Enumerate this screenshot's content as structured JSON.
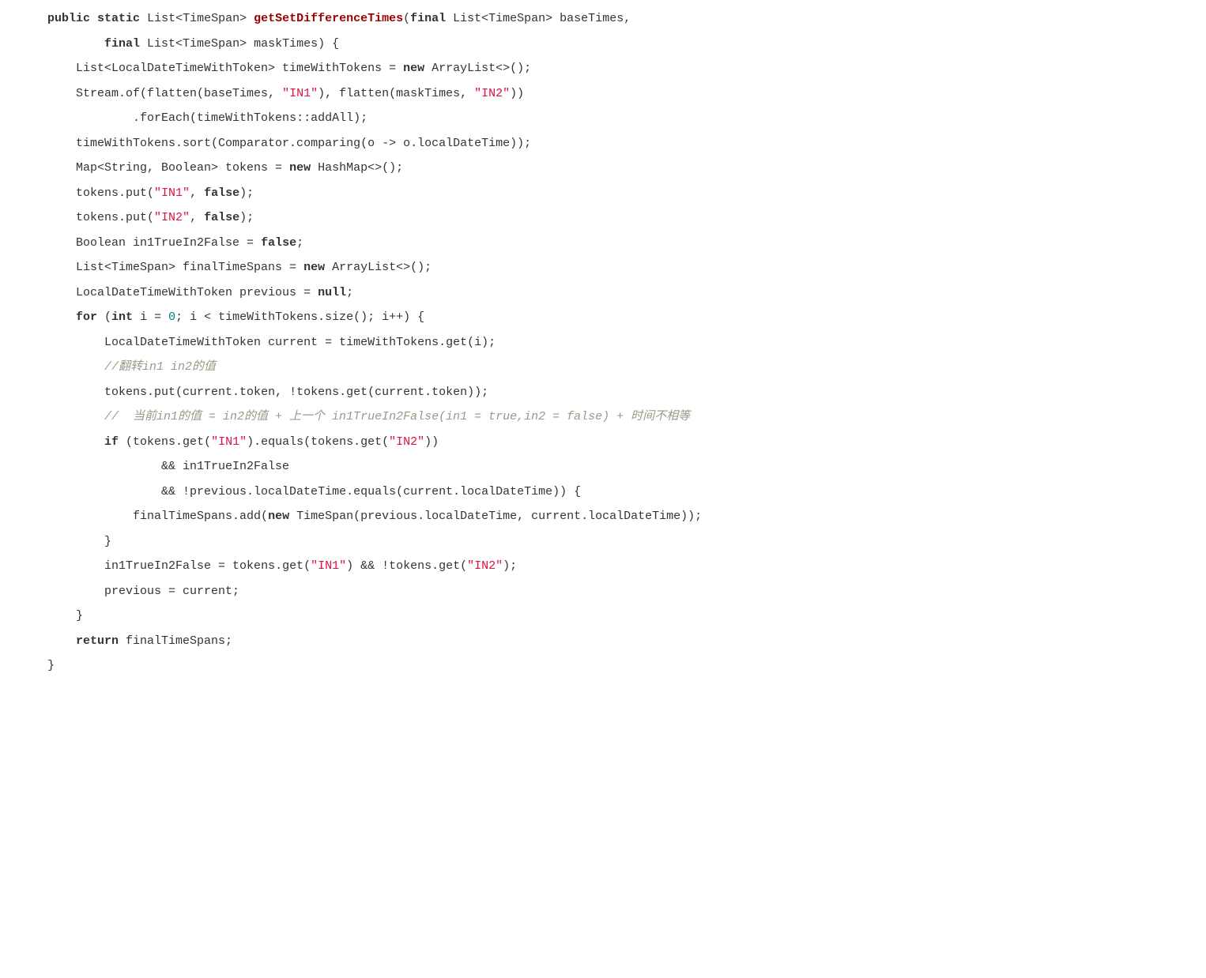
{
  "code": {
    "lines": [
      {
        "indent": 1,
        "tokens": [
          {
            "t": "public",
            "c": "kw"
          },
          {
            "t": " ",
            "c": "plain"
          },
          {
            "t": "static",
            "c": "kw"
          },
          {
            "t": " List<TimeSpan> ",
            "c": "plain"
          },
          {
            "t": "getSetDifferenceTimes",
            "c": "fn"
          },
          {
            "t": "(",
            "c": "plain"
          },
          {
            "t": "final",
            "c": "kw"
          },
          {
            "t": " List<TimeSpan> baseTimes,",
            "c": "plain"
          }
        ]
      },
      {
        "indent": 3,
        "tokens": [
          {
            "t": "final",
            "c": "kw"
          },
          {
            "t": " List<TimeSpan> maskTimes) {",
            "c": "plain"
          }
        ]
      },
      {
        "indent": 0,
        "tokens": [
          {
            "t": "",
            "c": "plain"
          }
        ]
      },
      {
        "indent": 2,
        "tokens": [
          {
            "t": "List<LocalDateTimeWithToken> timeWithTokens = ",
            "c": "plain"
          },
          {
            "t": "new",
            "c": "kw"
          },
          {
            "t": " ArrayList<>();",
            "c": "plain"
          }
        ]
      },
      {
        "indent": 2,
        "tokens": [
          {
            "t": "Stream.of(flatten(baseTimes, ",
            "c": "plain"
          },
          {
            "t": "\"IN1\"",
            "c": "str"
          },
          {
            "t": "), flatten(maskTimes, ",
            "c": "plain"
          },
          {
            "t": "\"IN2\"",
            "c": "str"
          },
          {
            "t": "))",
            "c": "plain"
          }
        ]
      },
      {
        "indent": 4,
        "tokens": [
          {
            "t": ".forEach(timeWithTokens::addAll);",
            "c": "plain"
          }
        ]
      },
      {
        "indent": 2,
        "tokens": [
          {
            "t": "timeWithTokens.sort(Comparator.comparing(o -> o.localDateTime));",
            "c": "plain"
          }
        ]
      },
      {
        "indent": 2,
        "tokens": [
          {
            "t": "Map<String, Boolean> tokens = ",
            "c": "plain"
          },
          {
            "t": "new",
            "c": "kw"
          },
          {
            "t": " HashMap<>();",
            "c": "plain"
          }
        ]
      },
      {
        "indent": 2,
        "tokens": [
          {
            "t": "tokens.put(",
            "c": "plain"
          },
          {
            "t": "\"IN1\"",
            "c": "str"
          },
          {
            "t": ", ",
            "c": "plain"
          },
          {
            "t": "false",
            "c": "bool"
          },
          {
            "t": ");",
            "c": "plain"
          }
        ]
      },
      {
        "indent": 2,
        "tokens": [
          {
            "t": "tokens.put(",
            "c": "plain"
          },
          {
            "t": "\"IN2\"",
            "c": "str"
          },
          {
            "t": ", ",
            "c": "plain"
          },
          {
            "t": "false",
            "c": "bool"
          },
          {
            "t": ");",
            "c": "plain"
          }
        ]
      },
      {
        "indent": 0,
        "tokens": [
          {
            "t": "",
            "c": "plain"
          }
        ]
      },
      {
        "indent": 2,
        "tokens": [
          {
            "t": "Boolean in1TrueIn2False = ",
            "c": "plain"
          },
          {
            "t": "false",
            "c": "bool"
          },
          {
            "t": ";",
            "c": "plain"
          }
        ]
      },
      {
        "indent": 0,
        "tokens": [
          {
            "t": "",
            "c": "plain"
          }
        ]
      },
      {
        "indent": 2,
        "tokens": [
          {
            "t": "List<TimeSpan> finalTimeSpans = ",
            "c": "plain"
          },
          {
            "t": "new",
            "c": "kw"
          },
          {
            "t": " ArrayList<>();",
            "c": "plain"
          }
        ]
      },
      {
        "indent": 2,
        "tokens": [
          {
            "t": "LocalDateTimeWithToken previous = ",
            "c": "plain"
          },
          {
            "t": "null",
            "c": "kw"
          },
          {
            "t": ";",
            "c": "plain"
          }
        ]
      },
      {
        "indent": 2,
        "tokens": [
          {
            "t": "for",
            "c": "kw"
          },
          {
            "t": " (",
            "c": "plain"
          },
          {
            "t": "int",
            "c": "kw"
          },
          {
            "t": " i = ",
            "c": "plain"
          },
          {
            "t": "0",
            "c": "num"
          },
          {
            "t": "; i < timeWithTokens.size(); i++) {",
            "c": "plain"
          }
        ]
      },
      {
        "indent": 3,
        "tokens": [
          {
            "t": "LocalDateTimeWithToken current = timeWithTokens.get(i);",
            "c": "plain"
          }
        ]
      },
      {
        "indent": 3,
        "tokens": [
          {
            "t": "//翻转in1 in2的值",
            "c": "comment"
          }
        ]
      },
      {
        "indent": 3,
        "tokens": [
          {
            "t": "tokens.put(current.token, !tokens.get(current.token));",
            "c": "plain"
          }
        ]
      },
      {
        "indent": 3,
        "tokens": [
          {
            "t": "//  当前in1的值 = in2的值 + 上一个 in1TrueIn2False(in1 = true,in2 = false) + 时间不相等",
            "c": "comment"
          }
        ]
      },
      {
        "indent": 3,
        "tokens": [
          {
            "t": "if",
            "c": "kw"
          },
          {
            "t": " (tokens.get(",
            "c": "plain"
          },
          {
            "t": "\"IN1\"",
            "c": "str"
          },
          {
            "t": ").equals(tokens.get(",
            "c": "plain"
          },
          {
            "t": "\"IN2\"",
            "c": "str"
          },
          {
            "t": "))",
            "c": "plain"
          }
        ]
      },
      {
        "indent": 5,
        "tokens": [
          {
            "t": "&& in1TrueIn2False",
            "c": "plain"
          }
        ]
      },
      {
        "indent": 5,
        "tokens": [
          {
            "t": "&& !previous.localDateTime.equals(current.localDateTime)) {",
            "c": "plain"
          }
        ]
      },
      {
        "indent": 4,
        "tokens": [
          {
            "t": "finalTimeSpans.add(",
            "c": "plain"
          },
          {
            "t": "new",
            "c": "kw"
          },
          {
            "t": " TimeSpan(previous.localDateTime, current.localDateTime));",
            "c": "plain"
          }
        ]
      },
      {
        "indent": 3,
        "tokens": [
          {
            "t": "}",
            "c": "plain"
          }
        ]
      },
      {
        "indent": 3,
        "tokens": [
          {
            "t": "in1TrueIn2False = tokens.get(",
            "c": "plain"
          },
          {
            "t": "\"IN1\"",
            "c": "str"
          },
          {
            "t": ") && !tokens.get(",
            "c": "plain"
          },
          {
            "t": "\"IN2\"",
            "c": "str"
          },
          {
            "t": ");",
            "c": "plain"
          }
        ]
      },
      {
        "indent": 3,
        "tokens": [
          {
            "t": "previous = current;",
            "c": "plain"
          }
        ]
      },
      {
        "indent": 2,
        "tokens": [
          {
            "t": "}",
            "c": "plain"
          }
        ]
      },
      {
        "indent": 2,
        "tokens": [
          {
            "t": "return",
            "c": "kw"
          },
          {
            "t": " finalTimeSpans;",
            "c": "plain"
          }
        ]
      },
      {
        "indent": 1,
        "tokens": [
          {
            "t": "}",
            "c": "plain"
          }
        ]
      }
    ]
  }
}
